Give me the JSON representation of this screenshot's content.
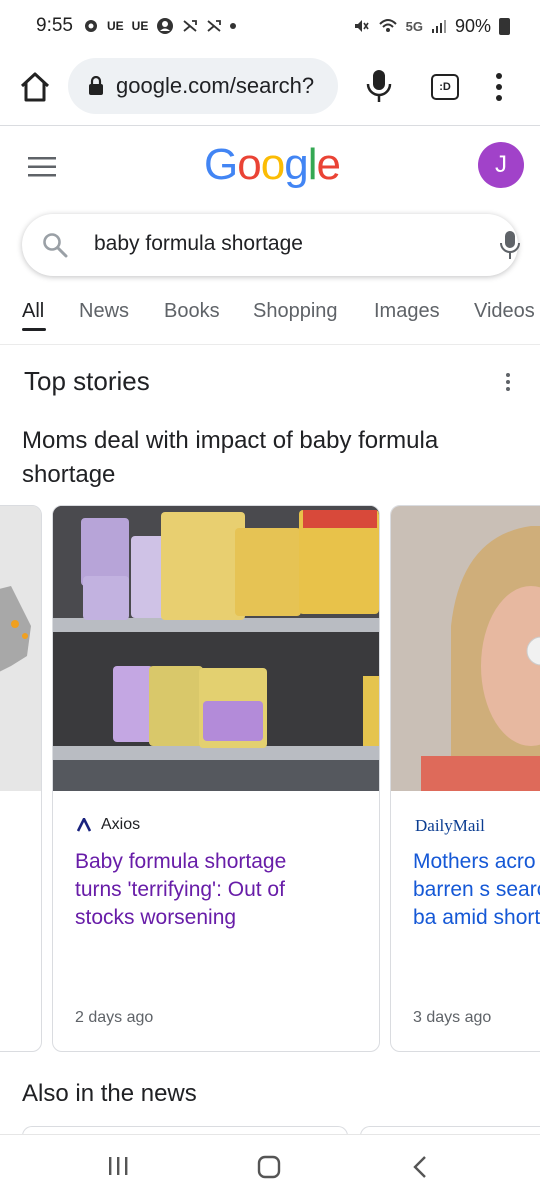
{
  "status_bar": {
    "time": "9:55",
    "left_indicators": [
      "UE",
      "UE"
    ],
    "network": "5G",
    "battery": "90%"
  },
  "browser": {
    "url": "google.com/search?",
    "tabs_label": ":D"
  },
  "google": {
    "logo_letters": [
      "G",
      "o",
      "o",
      "g",
      "l",
      "e"
    ],
    "avatar_initial": "J",
    "query": "baby formula shortage"
  },
  "search_tabs": [
    {
      "label": "All",
      "active": true
    },
    {
      "label": "News",
      "active": false
    },
    {
      "label": "Books",
      "active": false
    },
    {
      "label": "Shopping",
      "active": false
    },
    {
      "label": "Images",
      "active": false
    },
    {
      "label": "Videos",
      "active": false
    }
  ],
  "top_stories": {
    "section_title": "Top stories",
    "headline": "Moms deal with impact of baby formula shortage",
    "cards": [
      {
        "source": "Axios",
        "title": "Baby formula shortage turns 'terrifying': Out of stocks worsening",
        "time": "2 days ago"
      },
      {
        "source": "DailyMail",
        "title": "Mothers acro find barren s search for ba amid shortag",
        "time": "3 days ago"
      }
    ]
  },
  "also_in_the_news": {
    "section_title": "Also in the news"
  },
  "colors": {
    "google_blue": "#4285F4",
    "google_red": "#EA4335",
    "google_yellow": "#FBBC05",
    "google_green": "#34A853",
    "visited_link": "#681da8",
    "link": "#1558d6",
    "avatar_bg": "#a142c9"
  }
}
